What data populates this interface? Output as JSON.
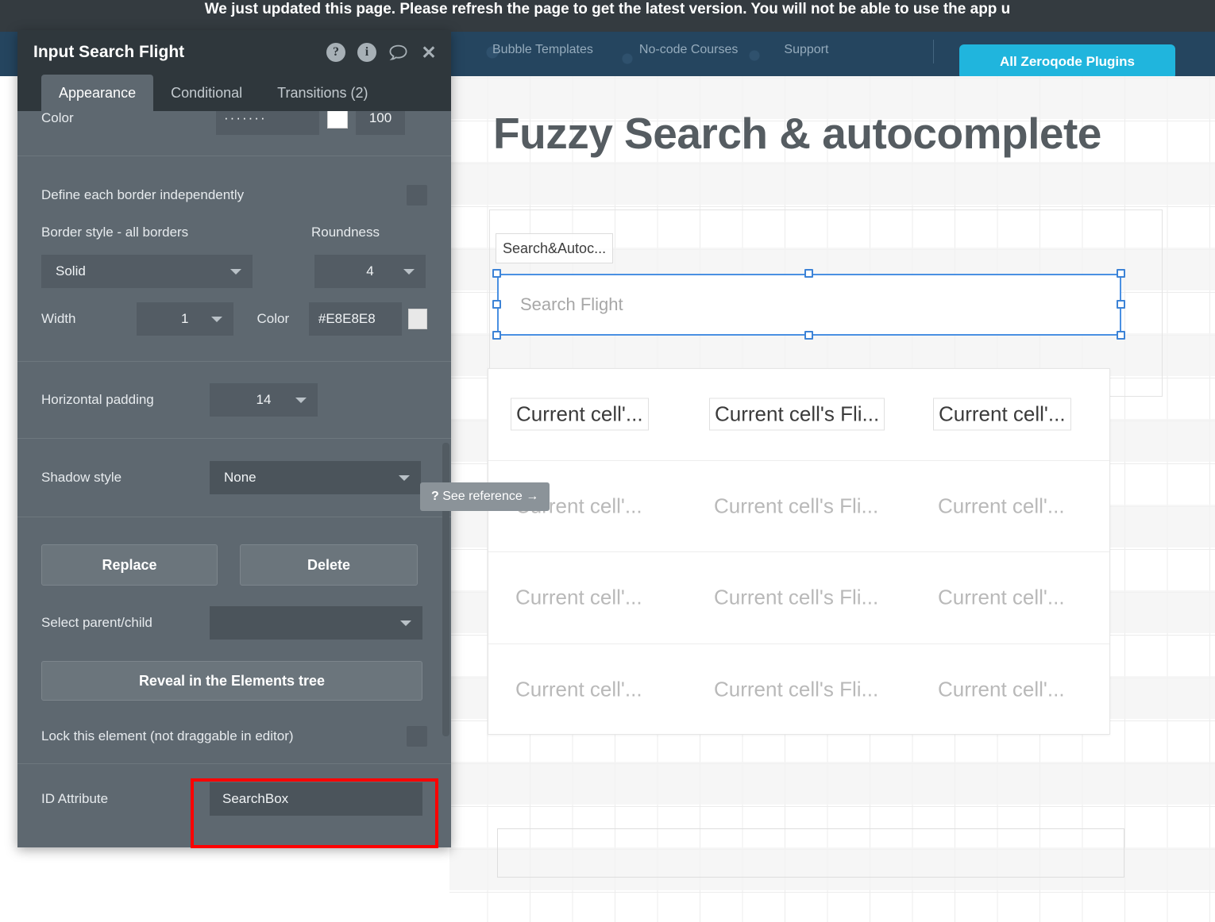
{
  "app": {
    "notice": "We just updated this page. Please refresh the page to get the latest version. You will not be able to use the app u",
    "nav": {
      "links": [
        {
          "label": "Bubble Templates"
        },
        {
          "label": "No-code Courses"
        },
        {
          "label": "Support"
        }
      ],
      "cta_label": "All Zeroqode Plugins",
      "cta_color": "#20b5dd"
    }
  },
  "canvas": {
    "page_title": "Fuzzy Search & autocomplete",
    "element_label": "Search&Autoc...",
    "search_input_placeholder": "Search Flight",
    "repeating_group": {
      "rows": [
        {
          "cells": [
            "Current cell'...",
            "Current cell's Fli...",
            "Current cell'..."
          ]
        },
        {
          "cells": [
            "Current cell'...",
            "Current cell's Fli...",
            "Current cell'..."
          ]
        },
        {
          "cells": [
            "Current cell'...",
            "Current cell's Fli...",
            "Current cell'..."
          ]
        },
        {
          "cells": [
            "Current cell'...",
            "Current cell's Fli...",
            "Current cell'..."
          ]
        }
      ]
    }
  },
  "panel": {
    "title": "Input Search Flight",
    "icons": {
      "help": "?",
      "info": "i",
      "comment": "speech-bubble-icon",
      "close": "✕"
    },
    "tabs": [
      {
        "label": "Appearance",
        "active": true
      },
      {
        "label": "Conditional",
        "active": false
      },
      {
        "label": "Transitions (2)",
        "active": false
      }
    ],
    "color_row": {
      "label": "Color",
      "value": "·······",
      "opacity": "100"
    },
    "define_borders": {
      "label": "Define each border independently",
      "checked": false
    },
    "border_style": {
      "label": "Border style - all borders",
      "value": "Solid"
    },
    "roundness": {
      "label": "Roundness",
      "value": "4"
    },
    "width": {
      "label": "Width",
      "value": "1"
    },
    "border_color": {
      "label": "Color",
      "value": "#E8E8E8",
      "swatch": "#E8E8E8"
    },
    "horizontal_padding": {
      "label": "Horizontal padding",
      "value": "14"
    },
    "shadow_style": {
      "label": "Shadow style",
      "value": "None"
    },
    "tooltip": {
      "marker": "?",
      "text": "See reference →"
    },
    "replace_label": "Replace",
    "delete_label": "Delete",
    "select_parent_child": {
      "label": "Select parent/child",
      "value": ""
    },
    "reveal_label": "Reveal in the Elements tree",
    "lock_element": {
      "label": "Lock this element (not draggable in editor)",
      "checked": false
    },
    "id_attribute": {
      "label": "ID Attribute",
      "value": "SearchBox"
    },
    "highlight_color": "#ff0000"
  }
}
